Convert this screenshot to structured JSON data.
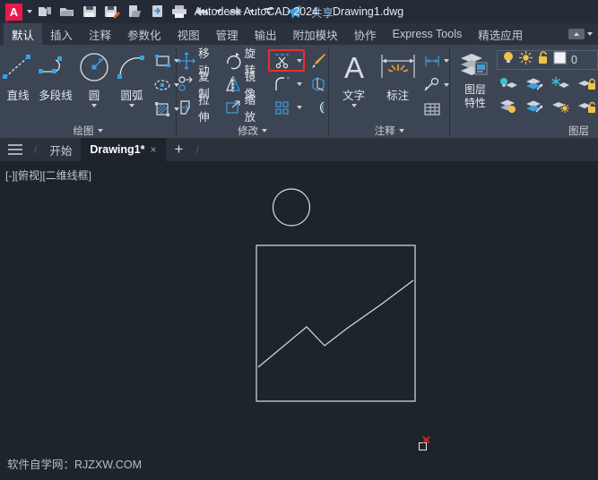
{
  "titlebar": {
    "logo": "A",
    "quick_access": [
      {
        "name": "new-icon",
        "label": "新建"
      },
      {
        "name": "open-icon",
        "label": "打开"
      },
      {
        "name": "save-icon",
        "label": "保存"
      },
      {
        "name": "save-as-icon",
        "label": "另存为"
      },
      {
        "name": "save-to-web-icon",
        "label": "保存到 Web"
      },
      {
        "name": "open-from-web-icon",
        "label": "从 Web 打开"
      },
      {
        "name": "plot-icon",
        "label": "打印"
      },
      {
        "name": "undo-icon",
        "label": "放弃"
      },
      {
        "name": "redo-icon",
        "label": "重做"
      },
      {
        "name": "customize-qat-icon",
        "label": "自定义快速访问工具栏"
      }
    ],
    "share_icon": "share-arrow-icon",
    "share_label": "共享",
    "app_title": "Autodesk AutoCAD 2024",
    "document_name": "Drawing1.dwg"
  },
  "ribbon_tabs": {
    "items": [
      {
        "label": "默认",
        "active": true
      },
      {
        "label": "插入",
        "active": false
      },
      {
        "label": "注释",
        "active": false
      },
      {
        "label": "参数化",
        "active": false
      },
      {
        "label": "视图",
        "active": false
      },
      {
        "label": "管理",
        "active": false
      },
      {
        "label": "输出",
        "active": false
      },
      {
        "label": "附加模块",
        "active": false
      },
      {
        "label": "协作",
        "active": false
      },
      {
        "label": "Express Tools",
        "active": false
      },
      {
        "label": "精选应用",
        "active": false
      }
    ]
  },
  "panels": {
    "draw": {
      "title": "绘图",
      "buttons": [
        {
          "label": "直线",
          "icon": "line-icon",
          "dropdown": false
        },
        {
          "label": "多段线",
          "icon": "polyline-icon",
          "dropdown": false
        },
        {
          "label": "圆",
          "icon": "circle-icon",
          "dropdown": true
        },
        {
          "label": "圆弧",
          "icon": "arc-icon",
          "dropdown": true
        }
      ],
      "small_buttons": [
        {
          "icon": "rectangle-icon",
          "label": "矩形",
          "dropdown": true
        },
        {
          "icon": "ellipse-icon",
          "label": "椭圆",
          "dropdown": true
        },
        {
          "icon": "hatch-icon",
          "label": "图案填充",
          "dropdown": true
        }
      ]
    },
    "modify": {
      "title": "修改",
      "rows": [
        [
          {
            "label": "移动",
            "icon": "move-icon",
            "highlighted": false
          },
          {
            "label": "旋转",
            "icon": "rotate-icon",
            "highlighted": false
          },
          {
            "label": "",
            "icon": "trim-scissors-icon",
            "highlighted": true,
            "dropdown": true
          },
          {
            "label": "",
            "icon": "erase-brush-icon",
            "highlighted": false
          }
        ],
        [
          {
            "label": "复制",
            "icon": "copy-icon",
            "highlighted": false
          },
          {
            "label": "镜像",
            "icon": "mirror-icon",
            "highlighted": false
          },
          {
            "label": "",
            "icon": "fillet-icon",
            "highlighted": false,
            "dropdown": true
          },
          {
            "label": "",
            "icon": "3d-array-icon",
            "highlighted": false
          }
        ],
        [
          {
            "label": "拉伸",
            "icon": "stretch-icon",
            "highlighted": false
          },
          {
            "label": "缩放",
            "icon": "scale-icon",
            "highlighted": false
          },
          {
            "label": "",
            "icon": "array-icon",
            "highlighted": false,
            "dropdown": true
          },
          {
            "label": "",
            "icon": "offset-icon",
            "highlighted": false
          }
        ]
      ]
    },
    "annotation": {
      "title": "注释",
      "buttons": [
        {
          "label": "文字",
          "icon": "text-a-icon",
          "dropdown": true
        },
        {
          "label": "标注",
          "icon": "dimension-icon",
          "dropdown": false
        }
      ],
      "small_buttons": [
        {
          "icon": "linear-dimension-icon",
          "label": "线性",
          "dropdown": true
        },
        {
          "icon": "leader-icon",
          "label": "引线",
          "dropdown": true
        },
        {
          "icon": "table-icon",
          "label": "表格",
          "dropdown": false
        }
      ]
    },
    "layers": {
      "title": "图层",
      "label_line1": "图层",
      "label_line2": "特性",
      "main_icon": "layer-properties-icon",
      "current_layer": "0",
      "state_icons": [
        "bulb-icon",
        "sun-icon",
        "unlock-icon",
        "color-swatch-icon"
      ],
      "grid_icons": [
        [
          "layer-off-icon",
          "layer-isolate-icon",
          "layer-freeze-icon",
          "layer-lock-icon"
        ],
        [
          "layer-on-icon",
          "layer-unisolate-icon",
          "layer-thaw-icon",
          "layer-unlock-icon"
        ]
      ]
    }
  },
  "doctabs": {
    "menu_icon": "hamburger-icon",
    "start_label": "开始",
    "items": [
      {
        "label": "Drawing1*",
        "active": true,
        "close": "×"
      }
    ],
    "new_tab": "+"
  },
  "canvas": {
    "viewport_label": "[-][俯视][二维线框]",
    "watermark": "软件自学网：RJZXW.COM",
    "cursor": {
      "x_mark": "✕",
      "pickbox": "pick-box-cursor"
    },
    "background": "#1e242c",
    "entity_color": "#d8dce2"
  },
  "colors": {
    "accent_red": "#e51c4b",
    "highlight_red": "#ef2d2d",
    "ribbon_bg": "#3c4554",
    "titlebar_bg": "#252b36",
    "tabbar_bg": "#2c323c",
    "icon_blue": "#3b9fe0",
    "icon_gray": "#d0d4da",
    "icon_yellow": "#f2c14a"
  }
}
